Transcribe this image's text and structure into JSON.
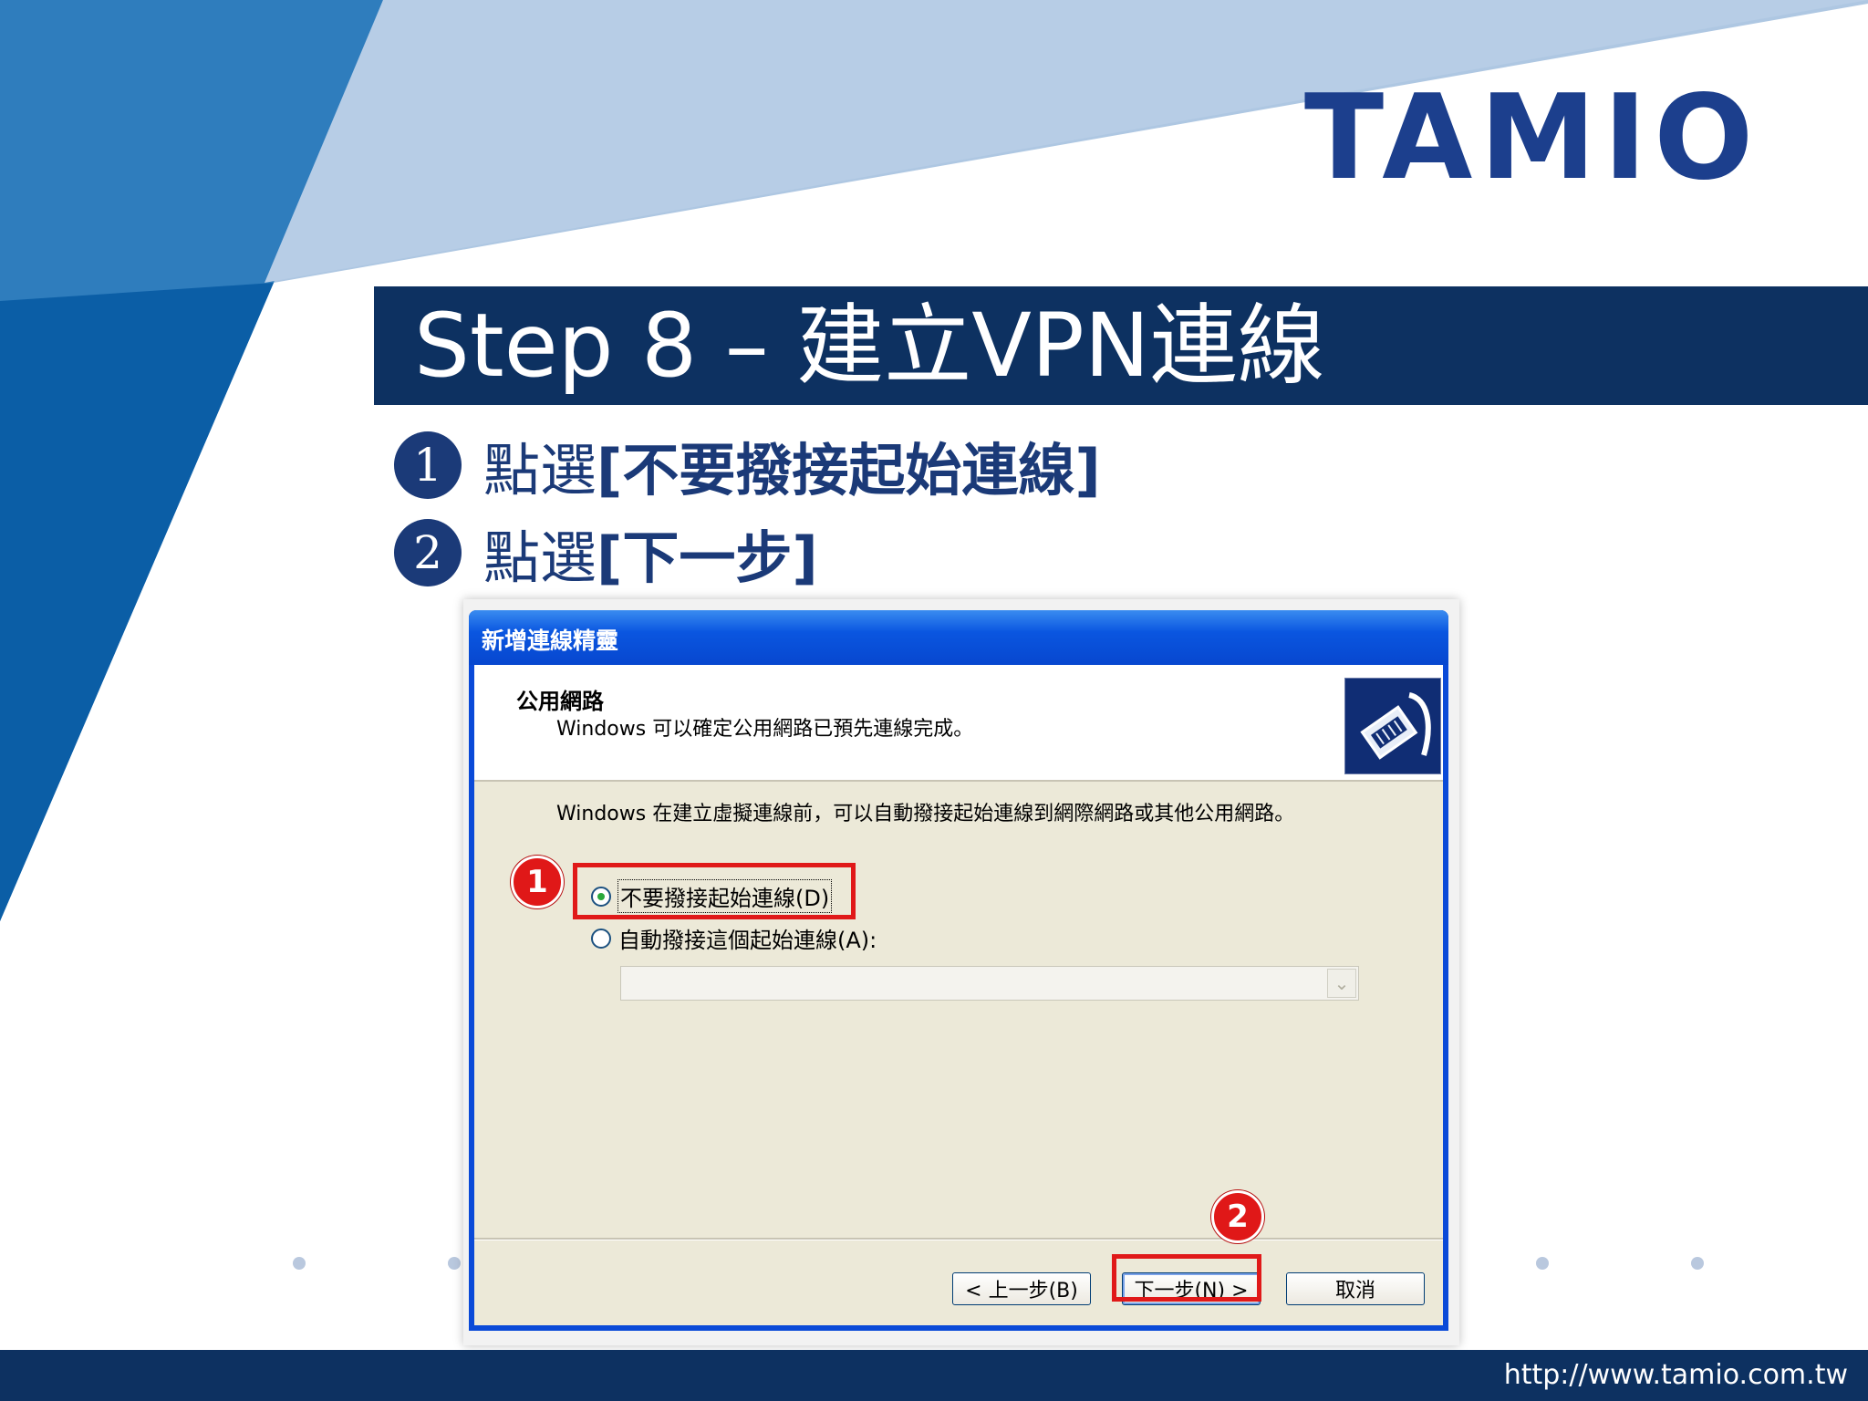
{
  "slide": {
    "logo": "TAMIO",
    "title": "Step 8 – 建立VPN連線",
    "steps": [
      {
        "num": "1",
        "prefix": "點選",
        "emphasis": "[不要撥接起始連線]"
      },
      {
        "num": "2",
        "prefix": "點選",
        "emphasis": "[下一步]"
      }
    ],
    "footer_url": "http://www.tamio.com.tw"
  },
  "dialog": {
    "title": "新增連線精靈",
    "header_title": "公用網路",
    "header_subtitle": "Windows 可以確定公用網路已預先連線完成。",
    "description": "Windows 在建立虛擬連線前，可以自動撥接起始連線到網際網路或其他公用網路。",
    "option_dont_dial": "不要撥接起始連線(D)",
    "option_auto_dial": "自動撥接這個起始連線(A):",
    "selected_option": "不要撥接起始連線(D)",
    "combo_value": "",
    "buttons": {
      "back": "< 上一步(B)",
      "next": "下一步(N) >",
      "cancel": "取消"
    }
  },
  "annotations": {
    "badge_1": "1",
    "badge_2": "2",
    "color": "#e01818"
  },
  "colors": {
    "navy": "#0d3161",
    "brand_blue": "#1c3f8d",
    "xp_title_blue": "#0a56e0",
    "dialog_body": "#ece9d8"
  }
}
